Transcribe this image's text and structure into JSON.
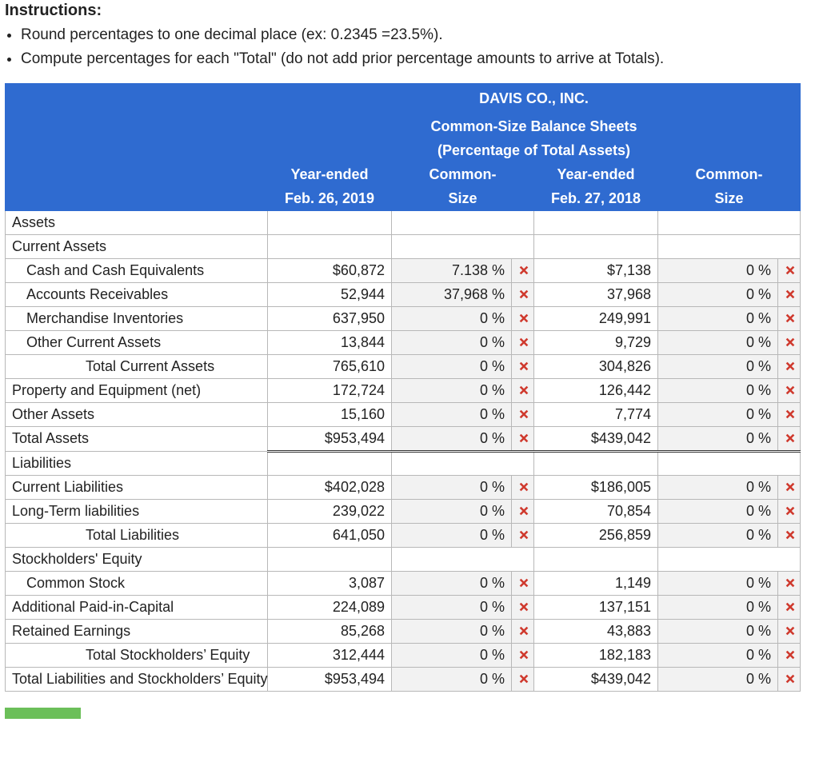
{
  "instructions_title": "Instructions:",
  "bullets": [
    "Round percentages to one decimal place (ex: 0.2345 =23.5%).",
    "Compute percentages for each \"Total\" (do not add prior percentage amounts to arrive at Totals)."
  ],
  "header": {
    "company": "DAVIS CO., INC.",
    "title": "Common-Size Balance Sheets",
    "subtitle": "(Percentage of Total Assets)",
    "col1a": "Year-ended",
    "col1b": "Feb. 26, 2019",
    "col2a": "Common-",
    "col2b": "Size",
    "col3a": "Year-ended",
    "col3b": "Feb. 27, 2018",
    "col4a": "Common-",
    "col4b": "Size"
  },
  "sections": {
    "assets": "Assets",
    "current_assets": "Current Assets",
    "liabilities": "Liabilities",
    "stockholders_equity": "Stockholders' Equity"
  },
  "rows": {
    "cash": {
      "label": "Cash and Cash Equivalents",
      "y2019": "$60,872",
      "p2019": "7.138 %",
      "y2018": "$7,138",
      "p2018": "0 %"
    },
    "ar": {
      "label": "Accounts Receivables",
      "y2019": "52,944",
      "p2019": "37,968 %",
      "y2018": "37,968",
      "p2018": "0 %"
    },
    "inv": {
      "label": "Merchandise Inventories",
      "y2019": "637,950",
      "p2019": "0 %",
      "y2018": "249,991",
      "p2018": "0 %"
    },
    "oca": {
      "label": "Other Current Assets",
      "y2019": "13,844",
      "p2019": "0 %",
      "y2018": "9,729",
      "p2018": "0 %"
    },
    "tca": {
      "label": "Total Current Assets",
      "y2019": "765,610",
      "p2019": "0 %",
      "y2018": "304,826",
      "p2018": "0 %"
    },
    "ppe": {
      "label": "Property and Equipment (net)",
      "y2019": "172,724",
      "p2019": "0 %",
      "y2018": "126,442",
      "p2018": "0 %"
    },
    "oa": {
      "label": "Other Assets",
      "y2019": "15,160",
      "p2019": "0 %",
      "y2018": "7,774",
      "p2018": "0 %"
    },
    "ta": {
      "label": "Total Assets",
      "y2019": "$953,494",
      "p2019": "0 %",
      "y2018": "$439,042",
      "p2018": "0 %"
    },
    "cl": {
      "label": "Current Liabilities",
      "y2019": "$402,028",
      "p2019": "0 %",
      "y2018": "$186,005",
      "p2018": "0 %"
    },
    "ltl": {
      "label": "Long-Term liabilities",
      "y2019": "239,022",
      "p2019": "0 %",
      "y2018": "70,854",
      "p2018": "0 %"
    },
    "tl": {
      "label": "Total Liabilities",
      "y2019": "641,050",
      "p2019": "0 %",
      "y2018": "256,859",
      "p2018": "0 %"
    },
    "cs": {
      "label": "Common Stock",
      "y2019": "3,087",
      "p2019": "0 %",
      "y2018": "1,149",
      "p2018": "0 %"
    },
    "apic": {
      "label": "Additional Paid-in-Capital",
      "y2019": "224,089",
      "p2019": "0 %",
      "y2018": "137,151",
      "p2018": "0 %"
    },
    "re": {
      "label": "Retained Earnings",
      "y2019": "85,268",
      "p2019": "0 %",
      "y2018": "43,883",
      "p2018": "0 %"
    },
    "tse": {
      "label": "Total Stockholders’ Equity",
      "y2019": "312,444",
      "p2019": "0 %",
      "y2018": "182,183",
      "p2018": "0 %"
    },
    "tlse": {
      "label": "Total Liabilities and Stockholders’ Equity",
      "y2019": "$953,494",
      "p2019": "0 %",
      "y2018": "$439,042",
      "p2018": "0 %"
    }
  }
}
